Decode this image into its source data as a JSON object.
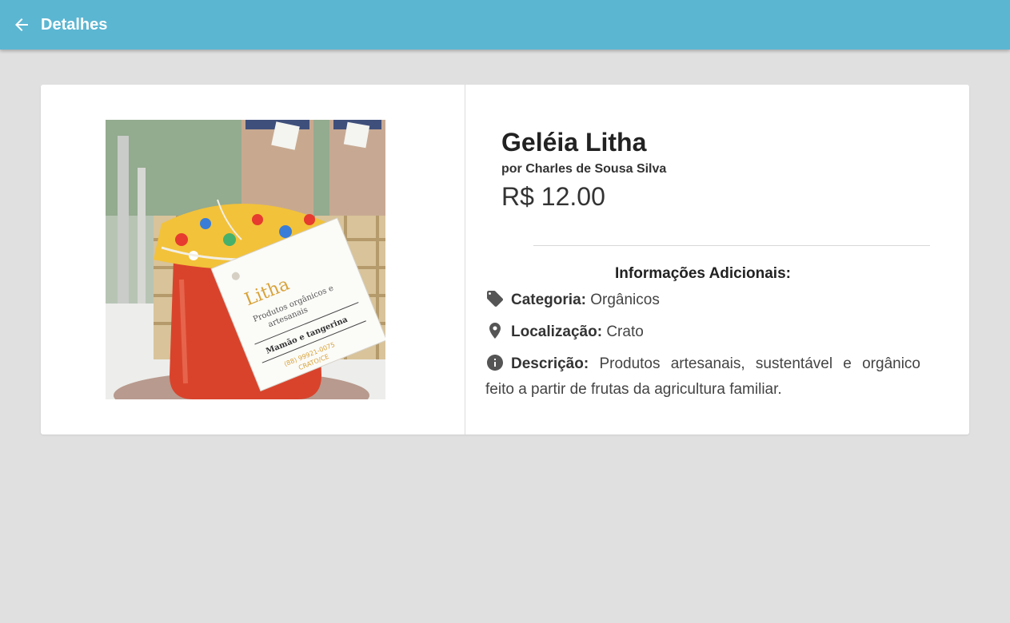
{
  "appbar": {
    "title": "Detalhes",
    "back_icon": "arrow-back-icon",
    "bg_color": "#5bb6d2"
  },
  "product": {
    "name": "Geléia Litha",
    "author": "por Charles de Sousa Silva",
    "price": "R$ 12.00",
    "image_label": {
      "brand": "Litha",
      "tagline_1": "Produtos orgânicos e",
      "tagline_2": "artesanais",
      "flavor": "Mamão e tangerina",
      "phone": "(88) 99921-0075",
      "city": "CRATO/CE"
    }
  },
  "additional": {
    "heading": "Informações Adicionais:",
    "category_label": "Categoria:",
    "category_value": "Orgânicos",
    "location_label": "Localização:",
    "location_value": "Crato",
    "description_label": "Descrição:",
    "description_value": "Produtos artesanais, sustentável e orgânico feito a partir de frutas da agricultura familiar."
  }
}
